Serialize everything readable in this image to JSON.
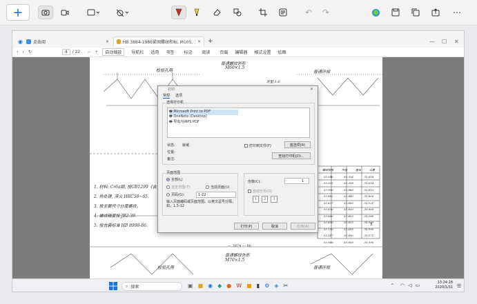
{
  "snip_toolbar": {
    "new_icon": "plus-icon",
    "tools": [
      "camera-icon",
      "video-icon",
      "rectangle-mode-icon",
      "timer-off-icon",
      "pen-icon",
      "highlighter-icon",
      "eraser-icon",
      "shapes-icon",
      "crop-icon",
      "text-actions-icon",
      "undo-icon",
      "redo-icon",
      "copilot-icon",
      "save-icon",
      "copy-icon",
      "share-icon",
      "more-icon"
    ]
  },
  "browser": {
    "tabs": [
      {
        "label": "点击阅"
      },
      {
        "label": "HB 3884-1986紧固螺纹和标, M105. 1.5~M..."
      }
    ],
    "new_tab_icon": "+",
    "pdf_toolbar": {
      "page_current": "4",
      "page_total": "/ 22",
      "zoom": "自动缩放",
      "items": [
        "导航栏",
        "适用",
        "书签",
        "标记",
        "阅读",
        "页眉",
        "编辑器",
        "格式设置",
        "绘图"
      ]
    }
  },
  "document": {
    "top_heading": "普通螺纹外形",
    "top_subheading": "M60×1.5",
    "left_label_top": "检验孔用",
    "right_label_top": "普通环规",
    "mid_label": "牙型 1:6",
    "footer_mark": "— 3874 — 86",
    "lower_heading": "普通螺纹外形",
    "lower_subheading": "M70×1.5",
    "lower_left_label": "检验孔用",
    "lower_right_label": "普通环规",
    "notes": [
      "1. 材料: Cr6a钢, 按GB1299《合金工具...",
      "2. 热处理, 淬火 HRC58~65.",
      "3. 按主要尺寸分度螺纹。",
      "4. 螺纹精度按 JB2-39.",
      "5. 按古典标准 HB 8998-86."
    ],
    "table_headers": [
      "螺纹规格",
      "中径",
      "基本",
      "公差"
    ],
    "table_rows": [
      [
        "33.946",
        "33.934",
        "33.618"
      ],
      [
        "33.925",
        "33.918",
        "33.614"
      ],
      [
        "33.900",
        "33.880",
        "33.613"
      ],
      [
        "33.862",
        "33.845",
        "33.600"
      ],
      [
        "33.827",
        "33.800",
        "33.521"
      ],
      [
        "33.830",
        "33.820",
        "33.605"
      ],
      [
        "33.860",
        "33.853",
        "33.580"
      ],
      [
        "33.830",
        "33.815",
        "33.595"
      ],
      [
        "33.190",
        "33.495",
        "33.590"
      ],
      [
        "33.117",
        "33.490",
        "33.571"
      ],
      [
        "33.946",
        "33.855",
        "33.590"
      ]
    ],
    "page_number": "3"
  },
  "print_dialog": {
    "title": "打印",
    "tabs": [
      "常规",
      "选项"
    ],
    "select_printer_label": "选择打印机",
    "printers": [
      "Microsoft Print to PDF",
      "OneNote (Desktop)",
      "导出为WPS PDF"
    ],
    "status_label": "状态:",
    "status_value": "就绪",
    "location_label": "位置:",
    "comment_label": "备注:",
    "print_to_file_label": "打印到文件(F)",
    "preferences_button": "首选项(R)",
    "find_printer_button": "查找打印机(D)...",
    "page_range_label": "页面范围",
    "all_label": "全部(L)",
    "selection_label": "选定范围(T)",
    "current_page_label": "当前页面(U)",
    "pages_label": "页码(G):",
    "pages_value": "1-22",
    "pages_hint": "输入页面编码或页面范围。以英文逗号分隔，如，1,5-12",
    "copies_label": "份数(C):",
    "copies_value": "1",
    "collate_label": "自动分页(O)",
    "collate_pages": [
      "1",
      "2",
      "3"
    ],
    "print_button": "打印(P)",
    "cancel_button": "取消",
    "apply_button": "应用(A)"
  },
  "taskbar": {
    "search_placeholder": "搜索",
    "time": "13:24:28",
    "date": "2020/1/31"
  }
}
